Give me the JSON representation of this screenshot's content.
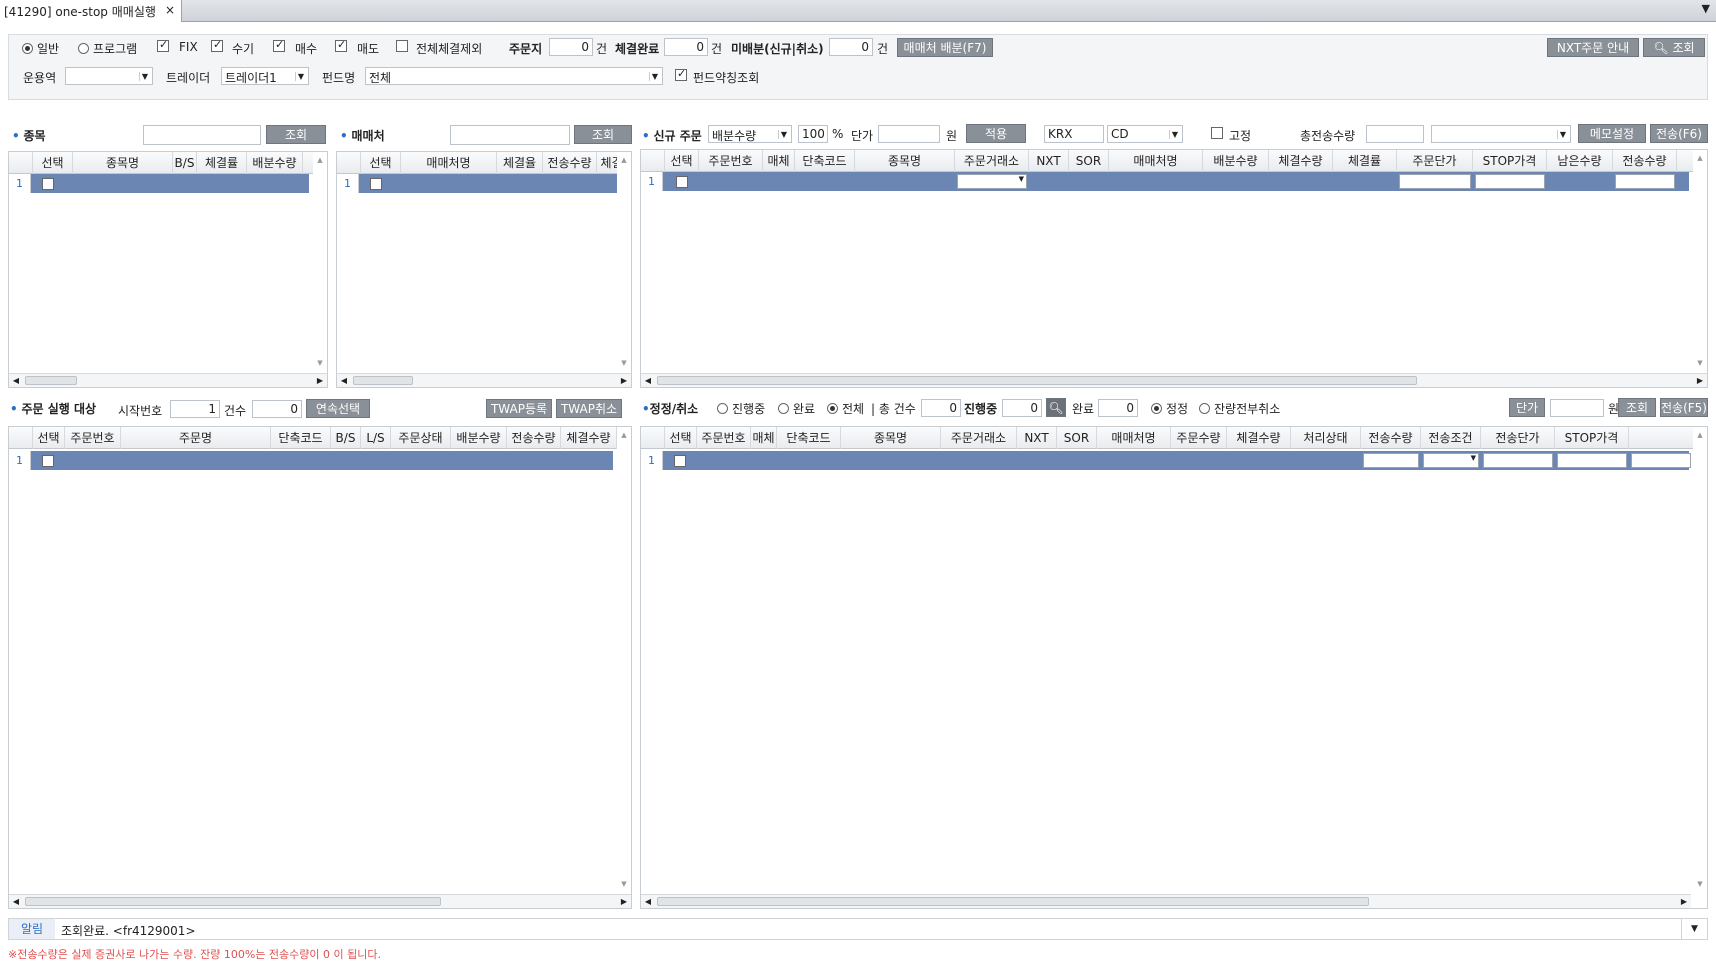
{
  "tab": {
    "title": "[41290] one-stop 매매실행",
    "close": "×"
  },
  "toolbar": {
    "radio_general": "일반",
    "radio_program": "프로그램",
    "fix": "FIX",
    "manual": "수기",
    "buy": "매수",
    "sell": "매도",
    "exclude_all_filled": "전체체결제외",
    "order_sheet_label": "주문지",
    "order_sheet_count": "0",
    "order_sheet_unit": "건",
    "filled_label": "체결완료",
    "filled_count": "0",
    "filled_unit": "건",
    "unallocated_label": "미배분(신규|취소)",
    "unallocated_count": "0",
    "unallocated_unit": "건",
    "broker_alloc_btn": "매매처 배분(F7)",
    "nxt_guide_btn": "NXT주문 안내",
    "search_btn": "조회",
    "manager_label": "운용역",
    "manager_value": "",
    "trader_label": "트레이더",
    "trader_value": "트레이더1",
    "fund_label": "펀드명",
    "fund_value": "전체",
    "fund_abbr": "펀드약칭조회"
  },
  "stock_panel": {
    "title": "종목",
    "search_value": "",
    "search_btn": "조회",
    "columns": [
      "선택",
      "종목명",
      "B/S",
      "체결률",
      "배분수량"
    ],
    "row_num": "1"
  },
  "broker_panel": {
    "title": "매매처",
    "search_value": "",
    "search_btn": "조회",
    "columns": [
      "선택",
      "매매처명",
      "체결율",
      "전송수량",
      "체결"
    ],
    "row_num": "1"
  },
  "new_order": {
    "title": "신규 주문",
    "alloc_type": "배분수량",
    "percent": "100",
    "percent_unit": "%",
    "price_label": "단가",
    "price_value": "",
    "price_unit": "원",
    "apply_btn": "적용",
    "exchange": "KRX",
    "exchange_code": "CD",
    "fixed": "고정",
    "total_send_label": "총전송수량",
    "total_send_value": "",
    "memo_btn": "메모설정",
    "send_btn": "전송(F6)",
    "columns": [
      "선택",
      "주문번호",
      "매체",
      "단축코드",
      "종목명",
      "주문거래소",
      "NXT",
      "SOR",
      "매매처명",
      "배분수량",
      "체결수량",
      "체결률",
      "주문단가",
      "STOP가격",
      "남은수량",
      "전송수량"
    ],
    "row_num": "1"
  },
  "exec_target": {
    "title": "주문 실행 대상",
    "start_label": "시작번호",
    "start_value": "1",
    "count_label": "건수",
    "count_value": "0",
    "cont_select_btn": "연속선택",
    "twap_reg_btn": "TWAP등록",
    "twap_cancel_btn": "TWAP취소",
    "columns": [
      "선택",
      "주문번호",
      "주문명",
      "단축코드",
      "B/S",
      "L/S",
      "주문상태",
      "배분수량",
      "전송수량",
      "체결수량"
    ],
    "row_num": "1"
  },
  "modify": {
    "title": "정정/취소",
    "in_progress": "진행중",
    "done": "완료",
    "all": "전체",
    "total_label": "| 총 건수",
    "total_value": "0",
    "progress_label": "진행중",
    "progress_value": "0",
    "done_label": "완료",
    "done_value": "0",
    "modify_radio": "정정",
    "cancel_remain_radio": "잔량전부취소",
    "price_btn": "단가",
    "price_value": "",
    "price_unit": "원",
    "search_btn": "조회",
    "send_btn": "전송(F5)",
    "columns": [
      "선택",
      "주문번호",
      "매체",
      "단축코드",
      "종목명",
      "주문거래소",
      "NXT",
      "SOR",
      "매매처명",
      "주문수량",
      "체결수량",
      "처리상태",
      "전송수량",
      "전송조건",
      "전송단가",
      "STOP가격"
    ],
    "row_num": "1"
  },
  "status": {
    "label": "알림",
    "message": "조회완료. <fr4129001>"
  },
  "note": "※전송수량은 실제 증권사로 나가는 수량. 잔량 100%는 전송수량이 0 이 됩니다."
}
